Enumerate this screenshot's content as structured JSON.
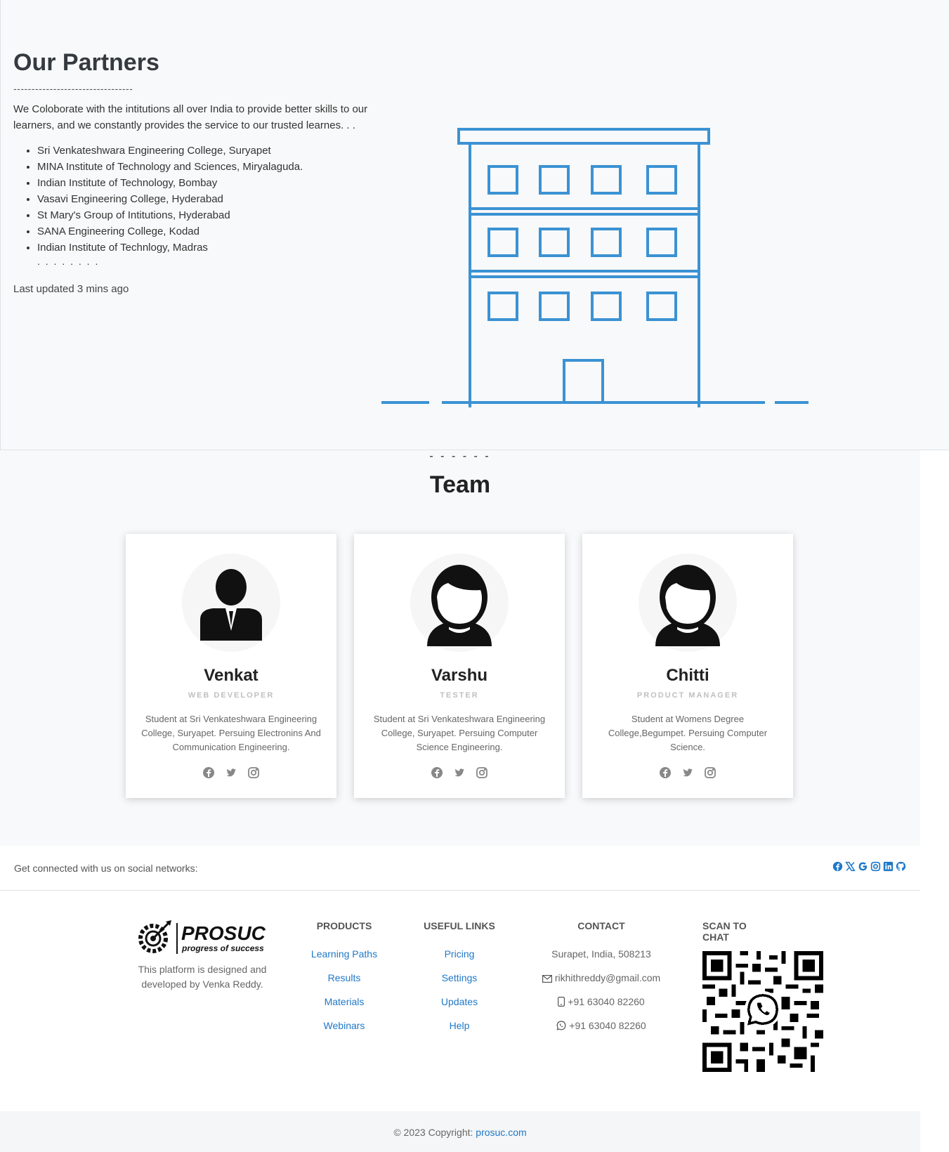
{
  "partners": {
    "title": "Our Partners",
    "divider": "---------------------------------",
    "description": "We Coloborate with the intitutions all over India to provide better skills to our learners, and we constantly provides the service to our trusted learnes. . .",
    "institutions": [
      "Sri Venkateshwara Engineering College, Suryapet",
      "MINA Institute of Technology and Sciences, Miryalaguda.",
      "Indian Institute of Technology, Bombay",
      "Vasavi Engineering College, Hyderabad",
      "St Mary's Group of Intitutions, Hyderabad",
      "SANA Engineering College, Kodad",
      "Indian Institute of Technlogy, Madras"
    ],
    "ellipsis": ". . . . . . . .",
    "updated": "Last updated 3 mins ago",
    "illustration_icon": "building-icon",
    "illustration_color": "#3b92d3"
  },
  "team": {
    "dashes": "- - - - - -",
    "title": "Team",
    "members": [
      {
        "name": "Venkat",
        "role": "WEB DEVELOPER",
        "desc": "Student at Sri Venkateshwara Engineering College, Suryapet. Persuing Electronins And Communication Engineering.",
        "avatar": "male-avatar-icon"
      },
      {
        "name": "Varshu",
        "role": "TESTER",
        "desc": "Student at Sri Venkateshwara Engineering College, Suryapet. Persuing Computer Science Engineering.",
        "avatar": "female-avatar-icon"
      },
      {
        "name": "Chitti",
        "role": "PRODUCT MANAGER",
        "desc": "Student at Womens Degree College,Begumpet. Persuing Computer Science.",
        "avatar": "female-avatar-icon"
      }
    ]
  },
  "social_bar": {
    "text": "Get connected with us on social networks:",
    "icons": [
      "facebook-icon",
      "x-icon",
      "google-icon",
      "instagram-icon",
      "linkedin-icon",
      "github-icon"
    ],
    "icon_color": "#1e78c8"
  },
  "footer": {
    "logo_text": "PROSUC",
    "logo_tagline": "progress of success",
    "logo_desc": "This platform is designed and developed by Venka Reddy.",
    "products": {
      "heading": "PRODUCTS",
      "links": [
        "Learning Paths",
        "Results",
        "Materials",
        "Webinars"
      ]
    },
    "useful": {
      "heading": "USEFUL LINKS",
      "links": [
        "Pricing",
        "Settings",
        "Updates",
        "Help"
      ]
    },
    "contact": {
      "heading": "CONTACT",
      "address": "Surapet, India, 508213",
      "email": "rikhithreddy@gmail.com",
      "phone": "+91 63040 82260",
      "whatsapp": "+91 63040 82260"
    },
    "scan": {
      "heading": "SCAN TO CHAT"
    },
    "link_color": "#1e78c8"
  },
  "copyright": {
    "text": "© 2023 Copyright: ",
    "link": "prosuc.com"
  }
}
